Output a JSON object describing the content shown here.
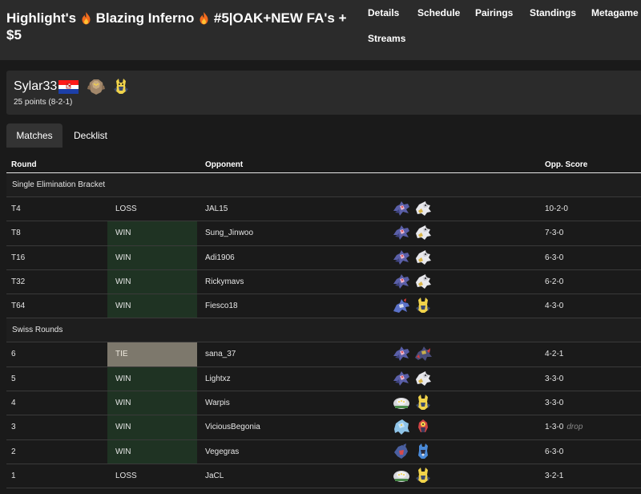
{
  "event": {
    "title_part1": "Highlight's",
    "title_part2": "Blazing Inferno",
    "title_part3": "#5|OAK+NEW FA's + $5"
  },
  "nav": [
    "Details",
    "Schedule",
    "Pairings",
    "Standings",
    "Metagame",
    "Streams"
  ],
  "player": {
    "name": "Sylar33",
    "points": "25 points (8-2-1)",
    "flag": "croatia-flag",
    "pokemon_icons": [
      "regirock-icon",
      "zeraora-icon"
    ]
  },
  "tabs": [
    "Matches",
    "Decklist"
  ],
  "table": {
    "headers": {
      "round": "Round",
      "opponent": "Opponent",
      "score": "Opp. Score"
    },
    "sections": [
      {
        "title": "Single Elimination Bracket",
        "rows": [
          {
            "round": "T4",
            "result": "LOSS",
            "opponent": "JAL15",
            "deck": [
              "palkia-origin-icon",
              "arceus-icon"
            ],
            "score": "10-2-0"
          },
          {
            "round": "T8",
            "result": "WIN",
            "opponent": "Sung_Jinwoo",
            "deck": [
              "palkia-origin-icon",
              "arceus-icon"
            ],
            "score": "7-3-0"
          },
          {
            "round": "T16",
            "result": "WIN",
            "opponent": "Adi1906",
            "deck": [
              "palkia-origin-icon",
              "arceus-icon"
            ],
            "score": "6-3-0"
          },
          {
            "round": "T32",
            "result": "WIN",
            "opponent": "Rickymavs",
            "deck": [
              "palkia-origin-icon",
              "arceus-icon"
            ],
            "score": "6-2-0"
          },
          {
            "round": "T64",
            "result": "WIN",
            "opponent": "Fiesco18",
            "deck": [
              "lugia-icon",
              "zeraora-icon"
            ],
            "score": "4-3-0"
          }
        ]
      },
      {
        "title": "Swiss Rounds",
        "rows": [
          {
            "round": "6",
            "result": "TIE",
            "opponent": "sana_37",
            "deck": [
              "palkia-origin-icon",
              "giratina-icon"
            ],
            "score": "4-2-1"
          },
          {
            "round": "5",
            "result": "WIN",
            "opponent": "Lightxz",
            "deck": [
              "palkia-origin-icon",
              "arceus-icon"
            ],
            "score": "3-3-0"
          },
          {
            "round": "4",
            "result": "WIN",
            "opponent": "Warpis",
            "deck": [
              "regigigas-icon",
              "zeraora-icon"
            ],
            "score": "3-3-0"
          },
          {
            "round": "3",
            "result": "WIN",
            "opponent": "ViciousBegonia",
            "deck": [
              "kyurem-icon",
              "blacephalon-icon"
            ],
            "score": "1-3-0",
            "note": "drop"
          },
          {
            "round": "2",
            "result": "WIN",
            "opponent": "Vegegras",
            "deck": [
              "garchomp-icon",
              "lucario-icon"
            ],
            "score": "6-3-0"
          },
          {
            "round": "1",
            "result": "LOSS",
            "opponent": "JaCL",
            "deck": [
              "regigigas-icon",
              "zeraora-icon"
            ],
            "score": "3-2-1"
          }
        ]
      }
    ]
  },
  "colors": {
    "background": "#1a1a1a",
    "panel": "#2b2b2b",
    "win_cell": "#1f3323",
    "tie_cell": "#7d786c",
    "flame": "#f26b1d"
  }
}
